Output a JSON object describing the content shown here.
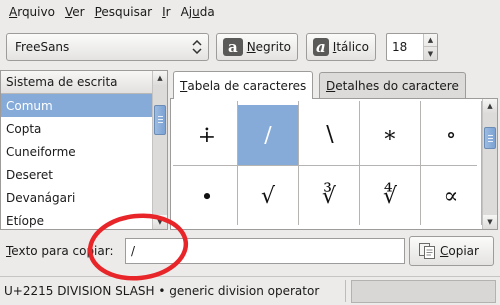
{
  "menubar": {
    "items": [
      {
        "pre": "",
        "mn": "A",
        "post": "rquivo"
      },
      {
        "pre": "",
        "mn": "V",
        "post": "er"
      },
      {
        "pre": "",
        "mn": "P",
        "post": "esquisar"
      },
      {
        "pre": "",
        "mn": "I",
        "post": "r"
      },
      {
        "pre": "Aj",
        "mn": "u",
        "post": "da"
      }
    ]
  },
  "toolbar": {
    "font_name": "FreeSans",
    "bold": {
      "icon_glyph": "a",
      "pre": "",
      "mn": "N",
      "post": "egrito"
    },
    "italic": {
      "icon_glyph": "a",
      "pre": "",
      "mn": "I",
      "post": "tálico"
    },
    "size_value": "18"
  },
  "script_list": {
    "header": "Sistema de escrita",
    "items": [
      "Comum",
      "Copta",
      "Cuneiforme",
      "Deseret",
      "Devanágari",
      "Etíope"
    ],
    "selected_index": 0
  },
  "tabs": [
    {
      "pre": "",
      "mn": "T",
      "post": "abela de caracteres",
      "active": true
    },
    {
      "pre": "",
      "mn": "D",
      "post": "etalhes do caractere",
      "active": false
    }
  ],
  "char_grid": {
    "cells": [
      "∔",
      "∕",
      "∖",
      "∗",
      "∘",
      "∙",
      "√",
      "∛",
      "∜",
      "∝"
    ],
    "selected_index": 1
  },
  "copy": {
    "label_pre": "",
    "label_mn": "T",
    "label_post": "exto para copiar:",
    "value": "/",
    "button_pre": "",
    "button_mn": "C",
    "button_post": "opiar"
  },
  "status": {
    "text": "U+2215 DIVISION SLASH  • generic division operator"
  },
  "colors": {
    "selection": "#86abd9",
    "annotation": "#e8262a"
  }
}
